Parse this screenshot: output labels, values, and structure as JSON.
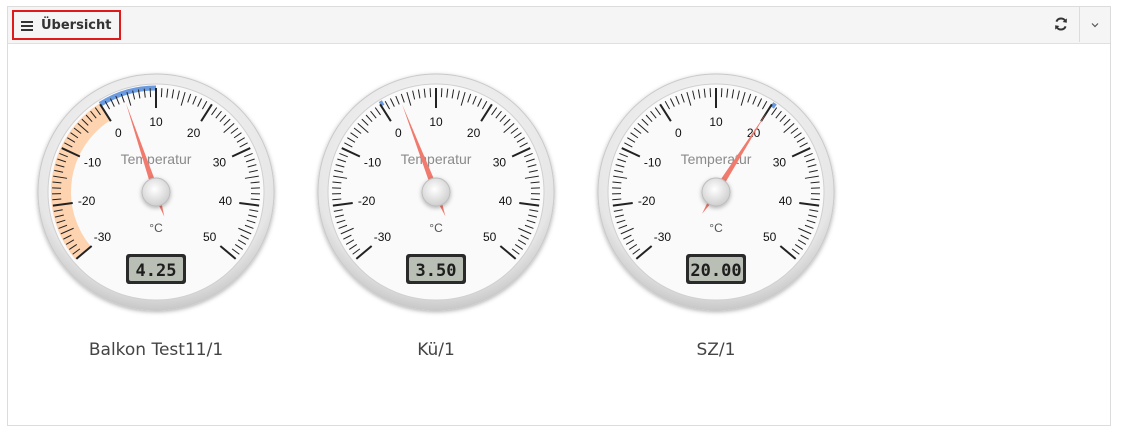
{
  "header": {
    "title": "Übersicht",
    "icons": {
      "menu": "hamburger-icon",
      "refresh": "refresh-icon",
      "collapse": "chevron-down-icon"
    }
  },
  "gauges": [
    {
      "label": "Balkon Test11/1",
      "value": 4.25,
      "display": "4.25",
      "title": "Temperatur",
      "unit": "°C",
      "min": -30,
      "max": 50,
      "highlight_range": [
        -30,
        0
      ],
      "highlight_color": "#fdd3b0",
      "peak_range": [
        0,
        10
      ]
    },
    {
      "label": "Kü/1",
      "value": 3.5,
      "display": "3.50",
      "title": "Temperatur",
      "unit": "°C",
      "min": -30,
      "max": 50,
      "peak_range": [
        0,
        0.6
      ]
    },
    {
      "label": "SZ/1",
      "value": 20.0,
      "display": "20.00",
      "title": "Temperatur",
      "unit": "°C",
      "min": -30,
      "max": 50,
      "peak_range": [
        20,
        20.7
      ]
    }
  ],
  "scale_labels": [
    "-30",
    "-20",
    "-10",
    "0",
    "10",
    "20",
    "30",
    "40",
    "50"
  ],
  "colors": {
    "needle": "#f07a6e",
    "peak": "#6a9be0",
    "lcd_bg": "#b9bfb4"
  }
}
